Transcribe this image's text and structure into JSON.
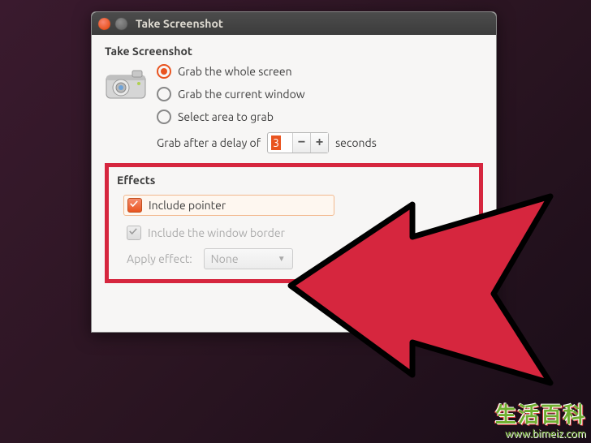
{
  "window": {
    "title": "Take Screenshot"
  },
  "grab": {
    "section_label": "Take Screenshot",
    "options": [
      {
        "label": "Grab the whole screen",
        "selected": true
      },
      {
        "label": "Grab the current window",
        "selected": false
      },
      {
        "label": "Select area to grab",
        "selected": false
      }
    ],
    "delay_prefix": "Grab after a delay of",
    "delay_value": "3",
    "delay_suffix": "seconds"
  },
  "effects": {
    "section_label": "Effects",
    "include_pointer_label": "Include pointer",
    "include_pointer_checked": true,
    "include_border_label": "Include the window border",
    "include_border_checked": true,
    "include_border_enabled": false,
    "apply_label": "Apply effect:",
    "apply_value": "None",
    "apply_enabled": false
  },
  "actions": {
    "take_label": "Take Screenshot"
  },
  "spin": {
    "minus": "−",
    "plus": "+"
  },
  "watermark": {
    "text": "生活百科",
    "url": "www.bimeiz.com"
  }
}
